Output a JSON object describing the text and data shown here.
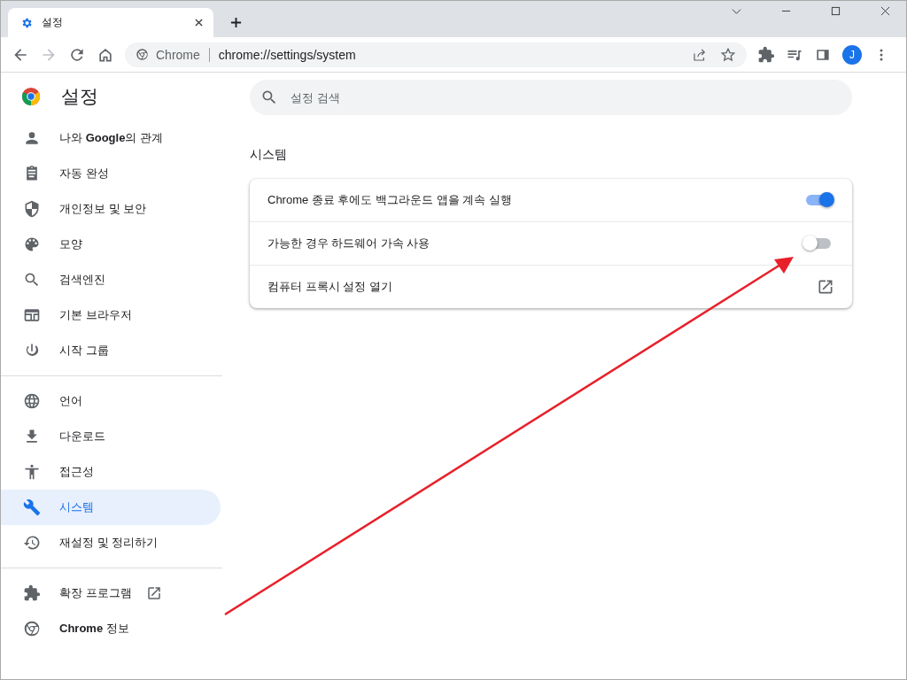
{
  "tabs": [
    {
      "title": "설정",
      "selected": true
    }
  ],
  "toolbar": {
    "site_label": "Chrome",
    "url": "chrome://settings/system",
    "avatar": "J"
  },
  "sidebar": {
    "title": "설정",
    "groups": [
      [
        {
          "label": "나와 **Google**의 관계",
          "selected": false
        },
        {
          "label": "자동 완성",
          "selected": false
        },
        {
          "label": "개인정보 및 보안",
          "selected": false
        },
        {
          "label": "모양",
          "selected": false
        },
        {
          "label": "검색엔진",
          "selected": false
        },
        {
          "label": "기본 브라우저",
          "selected": false
        },
        {
          "label": "시작 그룹",
          "selected": false
        }
      ],
      [
        {
          "label": "언어",
          "selected": false
        },
        {
          "label": "다운로드",
          "selected": false
        },
        {
          "label": "접근성",
          "selected": false
        },
        {
          "label": "시스템",
          "selected": true
        },
        {
          "label": "재설정 및 정리하기",
          "selected": false
        }
      ],
      [
        {
          "label": "확장 프로그램",
          "selected": false,
          "external": true
        },
        {
          "label": "**Chrome** 정보",
          "selected": false,
          "external": false
        }
      ]
    ]
  },
  "search": {
    "placeholder": "설정 검색"
  },
  "section": {
    "title": "시스템",
    "rows": [
      {
        "kind": "toggle",
        "label": "Chrome 종료 후에도 백그라운드 앱을 계속 실행",
        "on": true
      },
      {
        "kind": "toggle",
        "label": "가능한 경우 하드웨어 가속 사용",
        "on": false
      },
      {
        "kind": "link",
        "label": "컴퓨터 프록시 설정 열기"
      }
    ]
  }
}
